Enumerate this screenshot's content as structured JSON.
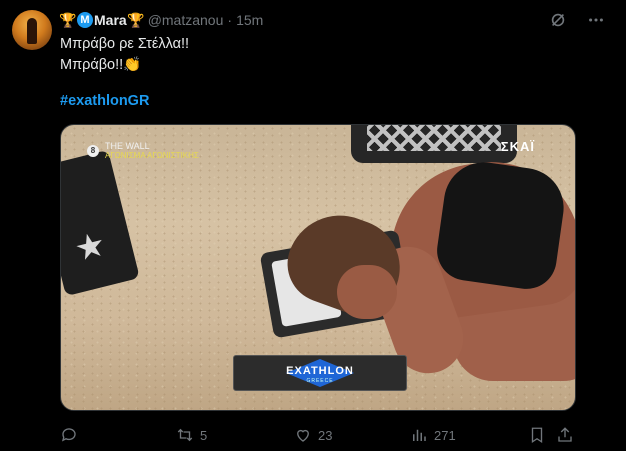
{
  "tweet": {
    "display_name": "Mara",
    "handle": "@matzanou",
    "separator": "·",
    "timestamp": "15m",
    "badge_letter": "M",
    "text_line1": "Μπράβο ρε Στέλλα!!",
    "text_line2": "Μπράβο!!👏",
    "hashtag": "#exathlonGR"
  },
  "media": {
    "show_logo_small": "8",
    "show_title": "THE WALL",
    "show_subtitle": "ΑΓΩΝΙΣΜΑ ΑΓΩΝΙΣΤΙΚΗΣ",
    "channel_logo": "ΣΚΑΪ",
    "banner_wordmark": "EXATHLON",
    "banner_country": "GREECE"
  },
  "actions": {
    "reply_count": "",
    "retweet_count": "5",
    "like_count": "23",
    "views_count": "271"
  },
  "icons": {
    "trophy": "trophy-icon",
    "grok": "grok-icon",
    "more": "more-icon",
    "reply": "reply-icon",
    "retweet": "retweet-icon",
    "like": "heart-icon",
    "views": "views-icon",
    "bookmark": "bookmark-icon",
    "share": "share-icon"
  },
  "colors": {
    "background": "#000000",
    "text": "#e7e9ea",
    "muted": "#71767b",
    "accent": "#1d9bf0"
  }
}
